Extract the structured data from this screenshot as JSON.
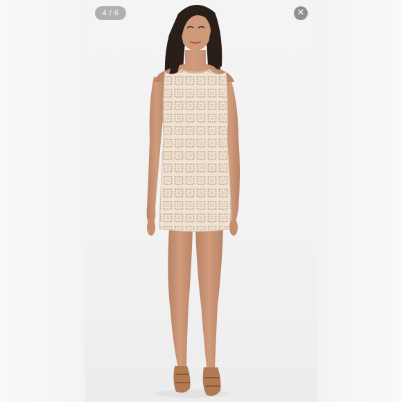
{
  "viewer": {
    "counter": "4 / 6",
    "close_icon": "close-icon",
    "close_glyph": "✕"
  },
  "photo": {
    "subject": "product-photo-model-crochet-dress",
    "dress_color": "#efe2d2",
    "skin_color": "#c99474",
    "hair_color": "#2a1e18"
  }
}
